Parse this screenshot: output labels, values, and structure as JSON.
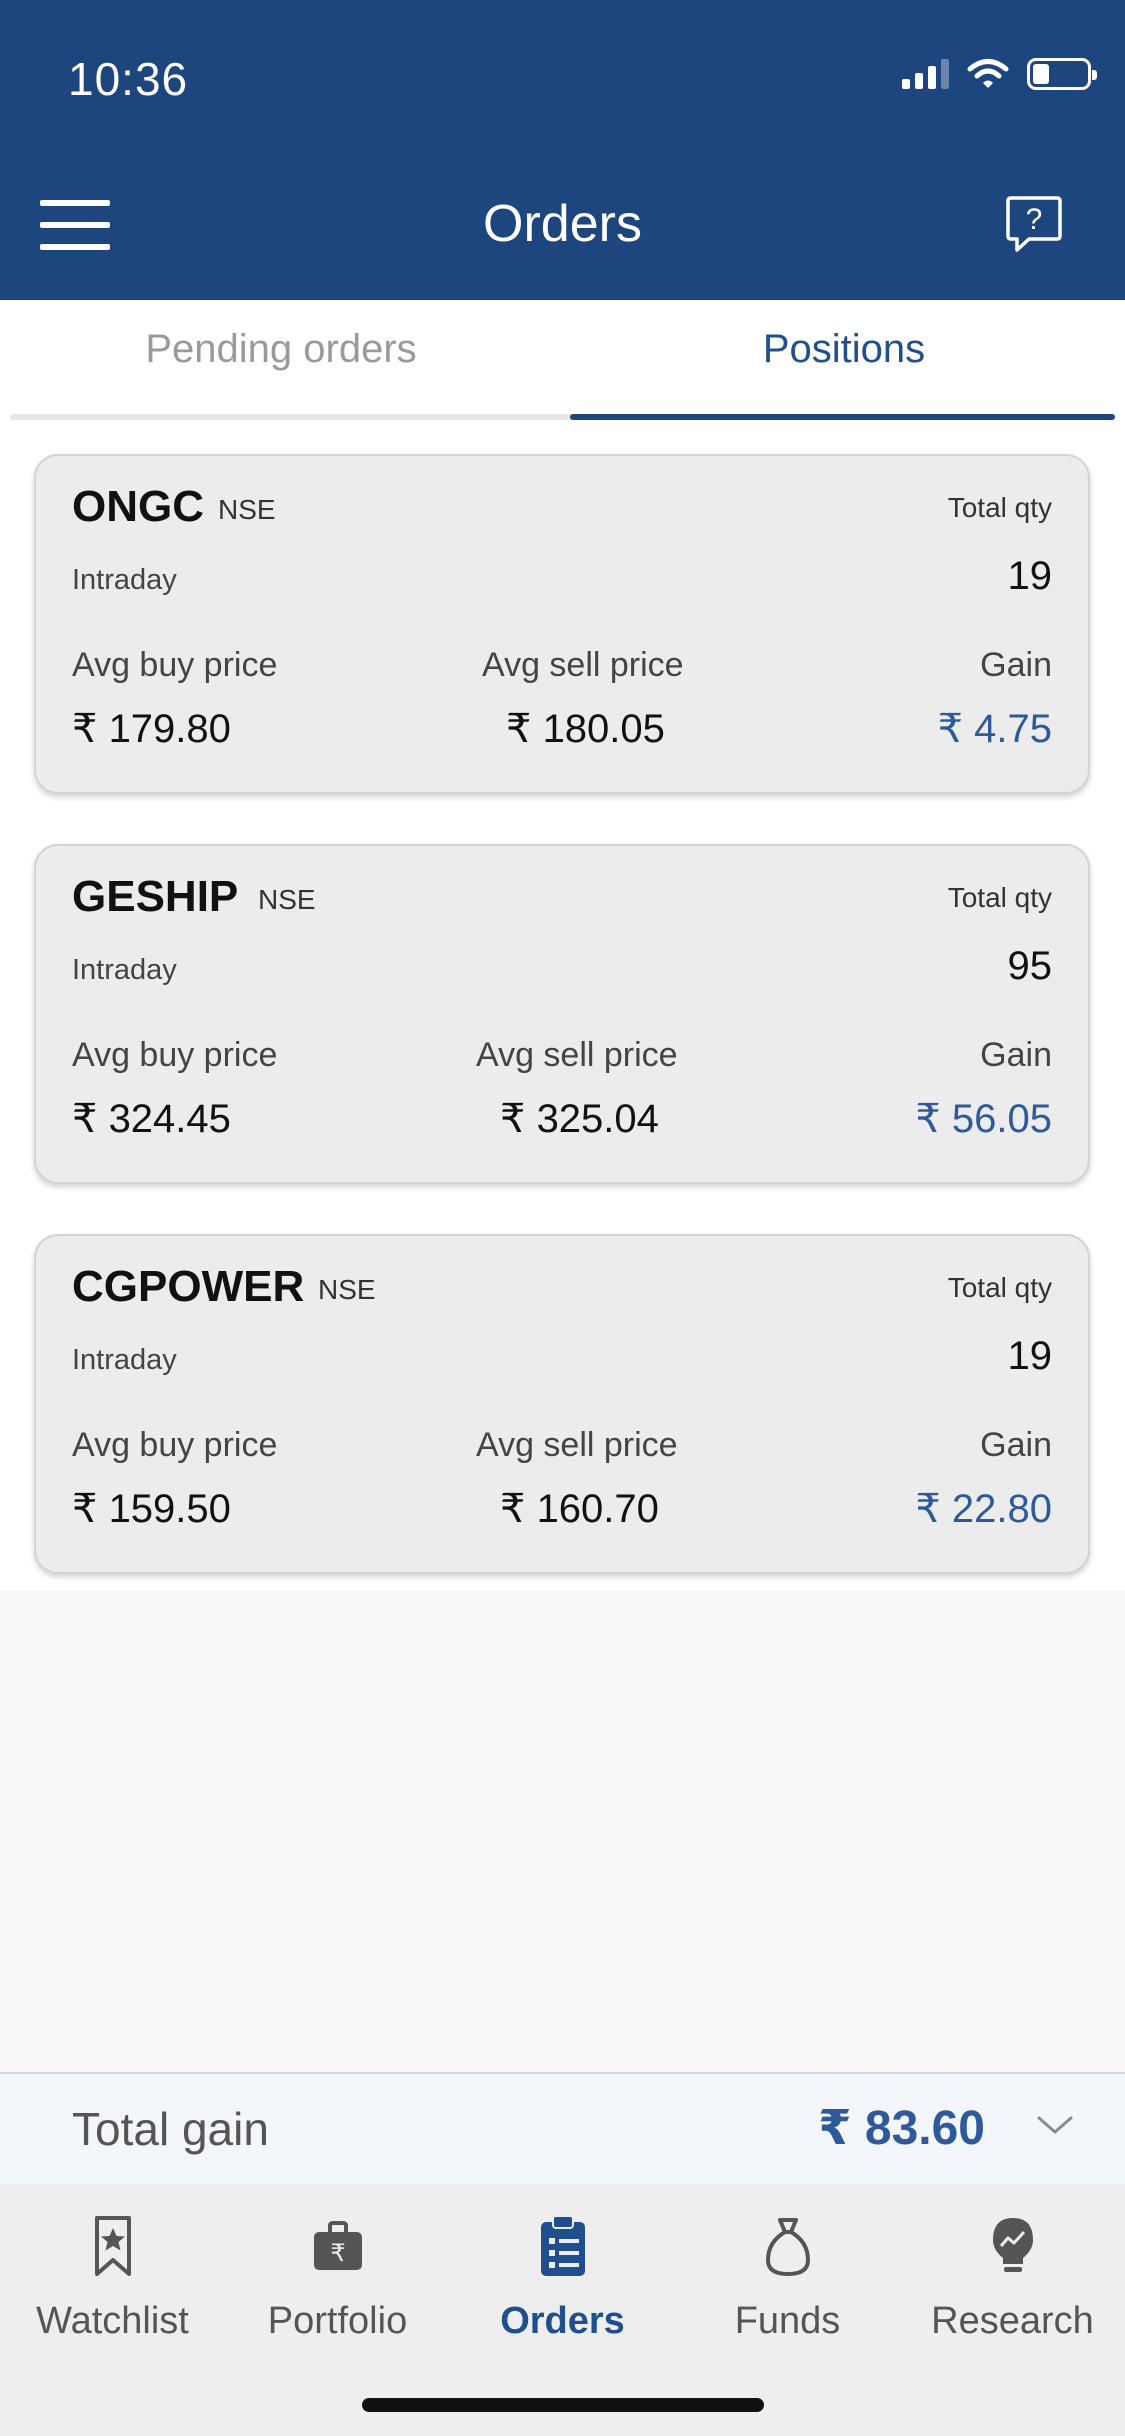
{
  "status": {
    "time": "10:36"
  },
  "header": {
    "title": "Orders"
  },
  "tabs": [
    {
      "label": "Pending orders",
      "active": false
    },
    {
      "label": "Positions",
      "active": true
    }
  ],
  "positions": [
    {
      "symbol": "ONGC",
      "exchange": "NSE",
      "qty_label": "Total qty",
      "product": "Intraday",
      "qty": "19",
      "buy_label": "Avg buy price",
      "sell_label": "Avg sell price",
      "gain_label": "Gain",
      "buy": "₹ 179.80",
      "sell": "₹ 180.05",
      "gain": "₹ 4.75"
    },
    {
      "symbol": "GESHIP",
      "exchange": "NSE",
      "qty_label": "Total qty",
      "product": "Intraday",
      "qty": "95",
      "buy_label": "Avg buy price",
      "sell_label": "Avg sell price",
      "gain_label": "Gain",
      "buy": "₹ 324.45",
      "sell": "₹ 325.04",
      "gain": "₹ 56.05"
    },
    {
      "symbol": "CGPOWER",
      "exchange": "NSE",
      "qty_label": "Total qty",
      "product": "Intraday",
      "qty": "19",
      "buy_label": "Avg buy price",
      "sell_label": "Avg sell price",
      "gain_label": "Gain",
      "buy": "₹ 159.50",
      "sell": "₹ 160.70",
      "gain": "₹ 22.80"
    }
  ],
  "total": {
    "label": "Total gain",
    "value": "₹ 83.60"
  },
  "nav": [
    {
      "label": "Watchlist",
      "icon": "bookmark-star-icon",
      "active": false
    },
    {
      "label": "Portfolio",
      "icon": "briefcase-rupee-icon",
      "active": false
    },
    {
      "label": "Orders",
      "icon": "clipboard-list-icon",
      "active": true
    },
    {
      "label": "Funds",
      "icon": "money-bag-icon",
      "active": false
    },
    {
      "label": "Research",
      "icon": "lightbulb-chart-icon",
      "active": false
    }
  ],
  "colors": {
    "header": "#1e467e",
    "accent": "#1f4f8f",
    "gain": "#2e5a9c"
  }
}
